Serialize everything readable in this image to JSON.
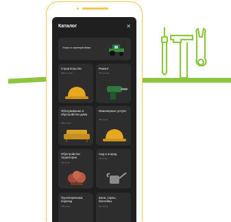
{
  "catalog": {
    "title": "Каталог",
    "promo": {
      "text": "Услуги от партнеров банка"
    },
    "categories": [
      {
        "title": "Строительство",
        "count": "6003 услуги"
      },
      {
        "title": "Ремонт",
        "count": "574 услуги"
      },
      {
        "title": "Обслуживание и обустройство дома",
        "count": "802 услуги"
      },
      {
        "title": "Инженерные услуги",
        "count": "327 услуг"
      },
      {
        "title": "Обустройство территории",
        "count": "310 услуг"
      },
      {
        "title": "Сад и огород",
        "count": "112 услуг"
      },
      {
        "title": "Грузоперевозки, переезд",
        "count": "208 услуг"
      },
      {
        "title": "Бани, сауны, бассейны",
        "count": "81 услуга"
      }
    ]
  },
  "colors": {
    "accent_green": "#8cc63f",
    "phone_frame": "#f4c84a",
    "screen_bg": "#1f1f1f",
    "card_bg": "#2d2d2d"
  }
}
